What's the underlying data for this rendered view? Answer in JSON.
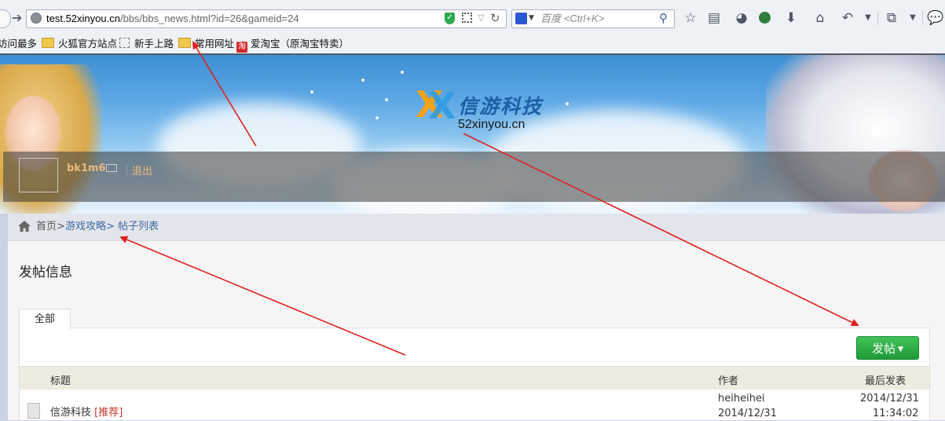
{
  "browser": {
    "url_host": "test.52xinyou.cn",
    "url_path": "/bbs/bbs_news.html?id=26&gameid=24",
    "search_placeholder": "百度 <Ctrl+K>",
    "bookmarks": [
      {
        "label": "访问最多",
        "icon": "folder-icon"
      },
      {
        "label": "火狐官方站点",
        "icon": "folder-icon"
      },
      {
        "label": "新手上路",
        "icon": "dashed-page-icon"
      },
      {
        "label": "常用网址",
        "icon": "folder-icon"
      },
      {
        "label": "爱淘宝（原淘宝特卖）",
        "icon": "taobao-icon"
      }
    ],
    "toolbar_icons": [
      "star-icon",
      "reading-list-icon",
      "palette-icon",
      "shield-addon-icon",
      "download-icon",
      "home-icon",
      "undo-icon",
      "dropdown-icon",
      "crop-icon",
      "dropdown-icon",
      "chat-icon"
    ]
  },
  "banner": {
    "logo_cn": "信游科技",
    "logo_en": "52xinyou.cn",
    "username": "bk1m6",
    "logout": "退出"
  },
  "breadcrumb": {
    "home": "首页>",
    "level2": "游戏攻略",
    "level3": "> 帖子列表"
  },
  "section_title": "发帖信息",
  "tab_all": "全部",
  "post_button": "发帖",
  "table": {
    "headers": {
      "title": "标题",
      "author": "作者",
      "last_post": "最后发表"
    },
    "rows": [
      {
        "title": "信游科技",
        "tag": "[推荐]",
        "author": "heiheihei",
        "author_date": "2014/12/31",
        "last_date": "2014/12/31",
        "last_time": "11:34:02"
      }
    ]
  },
  "colors": {
    "annotation_arrow": "#e0201c",
    "post_button": "#2aa845",
    "link": "#3b6aa0",
    "tag": "#c0392b"
  }
}
